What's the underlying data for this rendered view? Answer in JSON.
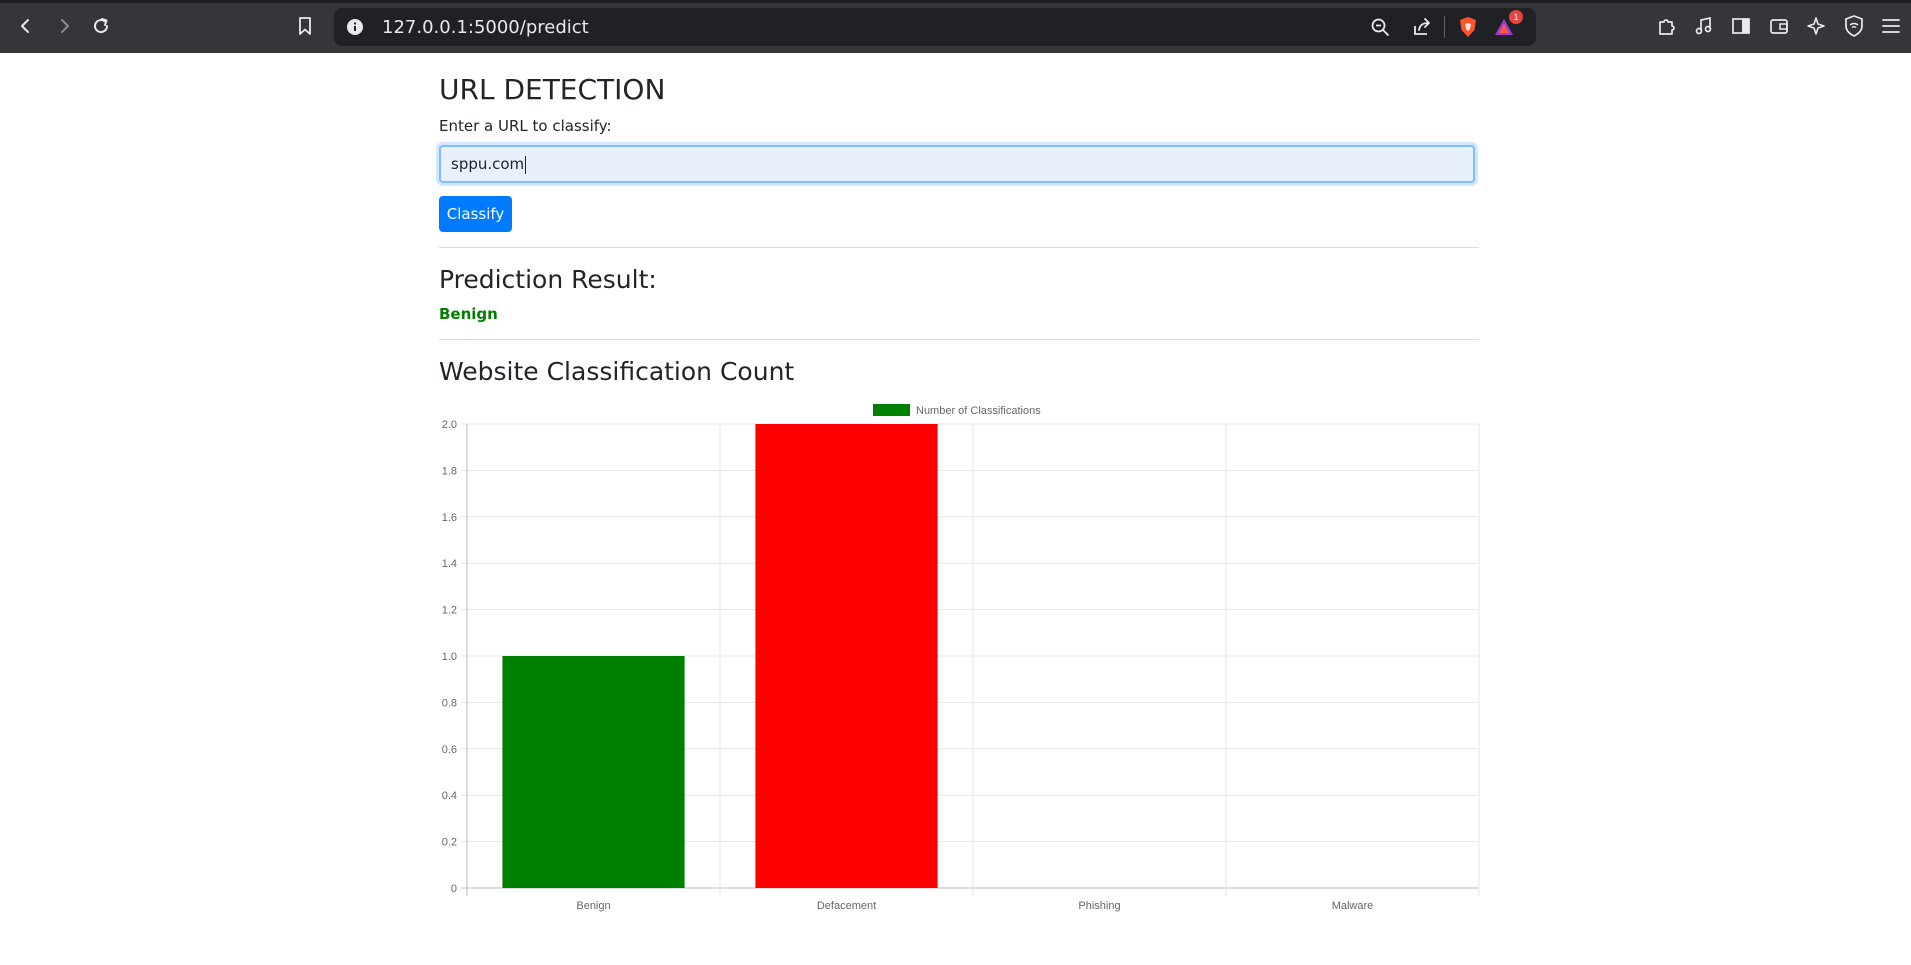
{
  "browser": {
    "url": "127.0.0.1:5000/predict",
    "shields_badge": "1",
    "icons": [
      "back-icon",
      "forward-icon",
      "reload-icon",
      "bookmark-icon",
      "info-icon",
      "zoom-out-icon",
      "share-icon",
      "brave-shields-icon",
      "brave-rewards-icon",
      "extensions-icon",
      "media-icon",
      "sidebar-icon",
      "wallet-icon",
      "leo-ai-icon",
      "vpn-icon",
      "menu-icon"
    ]
  },
  "page": {
    "title": "URL DETECTION",
    "input_label": "Enter a URL to classify:",
    "input_value": "sppu.com",
    "classify_button": "Classify",
    "result_heading": "Prediction Result:",
    "result_value": "Benign",
    "result_color": "#008000",
    "chart_heading": "Website Classification Count"
  },
  "chart_data": {
    "type": "bar",
    "categories": [
      "Benign",
      "Defacement",
      "Phishing",
      "Malware"
    ],
    "series": [
      {
        "name": "Number of Classifications",
        "values": [
          1,
          2,
          0,
          0
        ]
      }
    ],
    "colors": [
      "#008000",
      "#ff0000",
      "#ff8c00",
      "#800080"
    ],
    "legend_color": "#008000",
    "legend_position": "top",
    "ylim": [
      0,
      2
    ],
    "yticks": [
      "0",
      "0.2",
      "0.4",
      "0.6",
      "0.8",
      "1.0",
      "1.2",
      "1.4",
      "1.6",
      "1.8",
      "2.0"
    ],
    "grid": true
  }
}
